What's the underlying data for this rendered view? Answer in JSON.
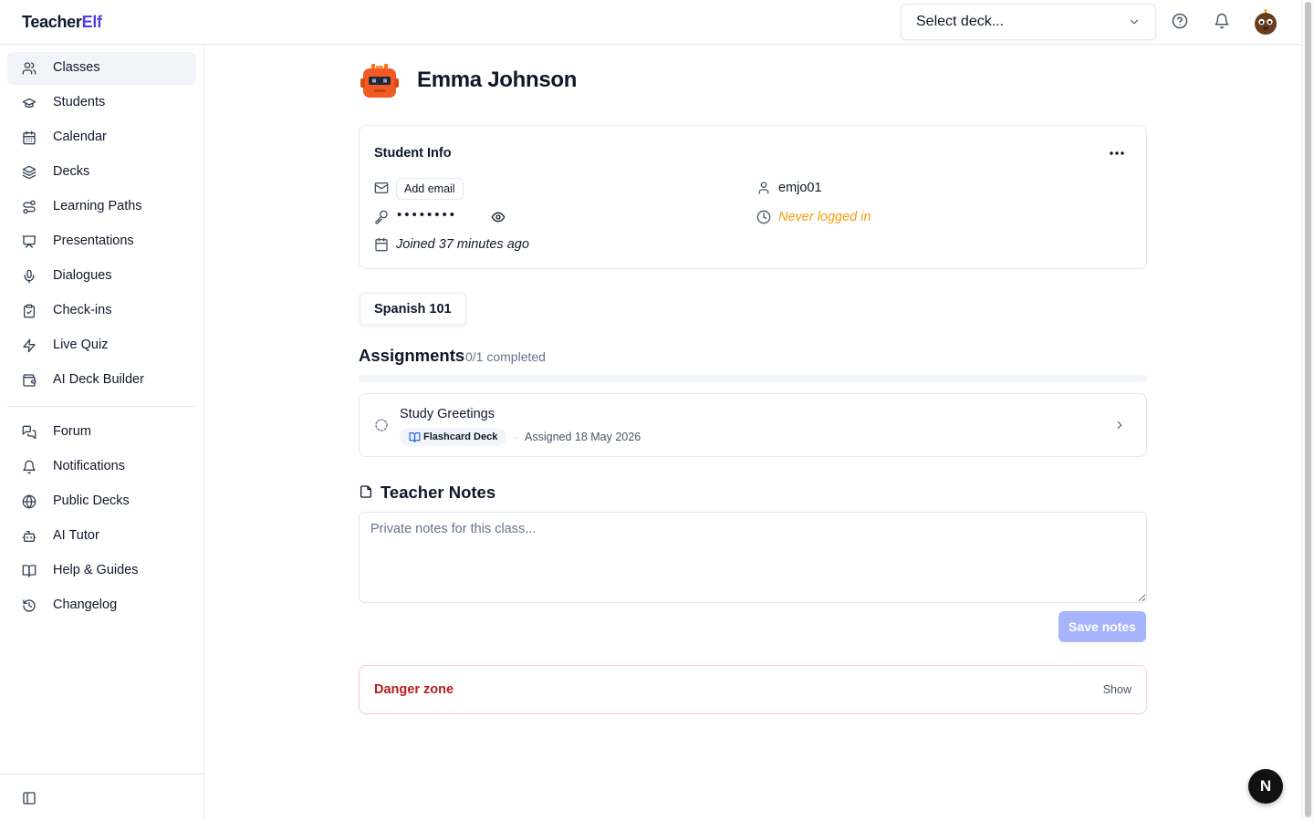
{
  "header": {
    "brand_part1": "Teacher",
    "brand_part2": "Elf",
    "deck_select_label": "Select deck...",
    "icons": [
      "help-icon",
      "bell-icon",
      "user-avatar"
    ]
  },
  "sidebar": {
    "items": [
      {
        "label": "Classes",
        "icon": "users-icon",
        "active": true
      },
      {
        "label": "Students",
        "icon": "graduation-cap-icon"
      },
      {
        "label": "Calendar",
        "icon": "calendar-icon"
      },
      {
        "label": "Decks",
        "icon": "layers-icon"
      },
      {
        "label": "Learning Paths",
        "icon": "route-icon"
      },
      {
        "label": "Presentations",
        "icon": "presentation-icon"
      },
      {
        "label": "Dialogues",
        "icon": "microphone-icon"
      },
      {
        "label": "Check-ins",
        "icon": "clipboard-check-icon"
      },
      {
        "label": "Live Quiz",
        "icon": "lightning-icon"
      },
      {
        "label": "AI Deck Builder",
        "icon": "wallet-icon"
      }
    ],
    "secondary_items": [
      {
        "label": "Forum",
        "icon": "messages-icon"
      },
      {
        "label": "Notifications",
        "icon": "bell-icon"
      },
      {
        "label": "Public Decks",
        "icon": "globe-icon"
      },
      {
        "label": "AI Tutor",
        "icon": "bot-icon"
      },
      {
        "label": "Help & Guides",
        "icon": "book-open-icon"
      },
      {
        "label": "Changelog",
        "icon": "history-icon"
      }
    ]
  },
  "student": {
    "name": "Emma Johnson",
    "info_title": "Student Info",
    "add_email_label": "Add email",
    "password_mask": "••••••••",
    "joined": "Joined 37 minutes ago",
    "username": "emjo01",
    "last_login": "Never logged in"
  },
  "class_tab": "Spanish 101",
  "assignments": {
    "title": "Assignments",
    "count_text": "0/1 completed",
    "progress": 0,
    "items": [
      {
        "name": "Study Greetings",
        "type": "Flashcard Deck",
        "assigned": "Assigned 18 May 2026"
      }
    ]
  },
  "notes": {
    "title": "Teacher Notes",
    "placeholder": "Private notes for this class...",
    "save_label": "Save notes"
  },
  "danger": {
    "title": "Danger zone",
    "toggle_label": "Show"
  },
  "fab_label": "N",
  "colors": {
    "brand_accent": "#5b3fd6",
    "warning_text": "#f59e0b",
    "danger_text": "#b91c1c",
    "save_button_disabled": "#a5b4fc"
  }
}
